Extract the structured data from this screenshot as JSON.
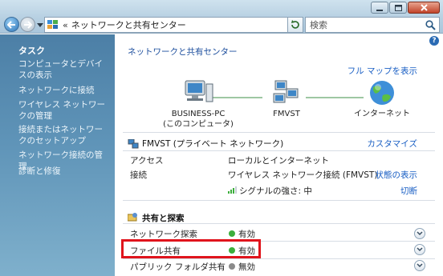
{
  "window": {
    "address": {
      "separator": "«",
      "path": "ネットワークと共有センター"
    },
    "search": {
      "placeholder": "検索"
    }
  },
  "sidebar": {
    "title": "タスク",
    "items": [
      {
        "label": "コンピュータとデバイスの表示"
      },
      {
        "label": "ネットワークに接続"
      },
      {
        "label": "ワイヤレス ネットワークの管理"
      },
      {
        "label": "接続またはネットワークのセットアップ"
      },
      {
        "label": "ネットワーク接続の管理"
      },
      {
        "label": "診断と修復"
      }
    ]
  },
  "main": {
    "breadcrumb": "ネットワークと共有センター",
    "full_map_link": "フル マップを表示",
    "help_label": "?",
    "map": {
      "nodes": [
        {
          "name": "BUSINESS-PC",
          "sub": "(このコンピュータ)",
          "icon": "computer-icon"
        },
        {
          "name": "FMVST",
          "sub": "",
          "icon": "network-icon"
        },
        {
          "name": "インターネット",
          "sub": "",
          "icon": "globe-icon"
        }
      ]
    },
    "network": {
      "name": "FMVST (プライベート ネットワーク)",
      "customize_link": "カスタマイズ",
      "rows": [
        {
          "label": "アクセス",
          "value": "ローカルとインターネット",
          "link": ""
        },
        {
          "label": "接続",
          "value": "ワイヤレス ネットワーク接続 (FMVST)",
          "link": "状態の表示"
        },
        {
          "label": "",
          "value": "シグナルの強さ: 中",
          "link": "切断"
        }
      ]
    },
    "sharing": {
      "title": "共有と探索",
      "rows": [
        {
          "label": "ネットワーク探索",
          "value": "有効",
          "status_color": "#3cae3c"
        },
        {
          "label": "ファイル共有",
          "value": "有効",
          "status_color": "#3cae3c"
        },
        {
          "label": "パブリック フォルダ共有",
          "value": "無効",
          "status_color": "#8a8a8a"
        }
      ]
    }
  },
  "colors": {
    "accent_link": "#1a5fc4",
    "highlight_border": "#e0141c",
    "sidebar_bg": "#5f94b8"
  }
}
